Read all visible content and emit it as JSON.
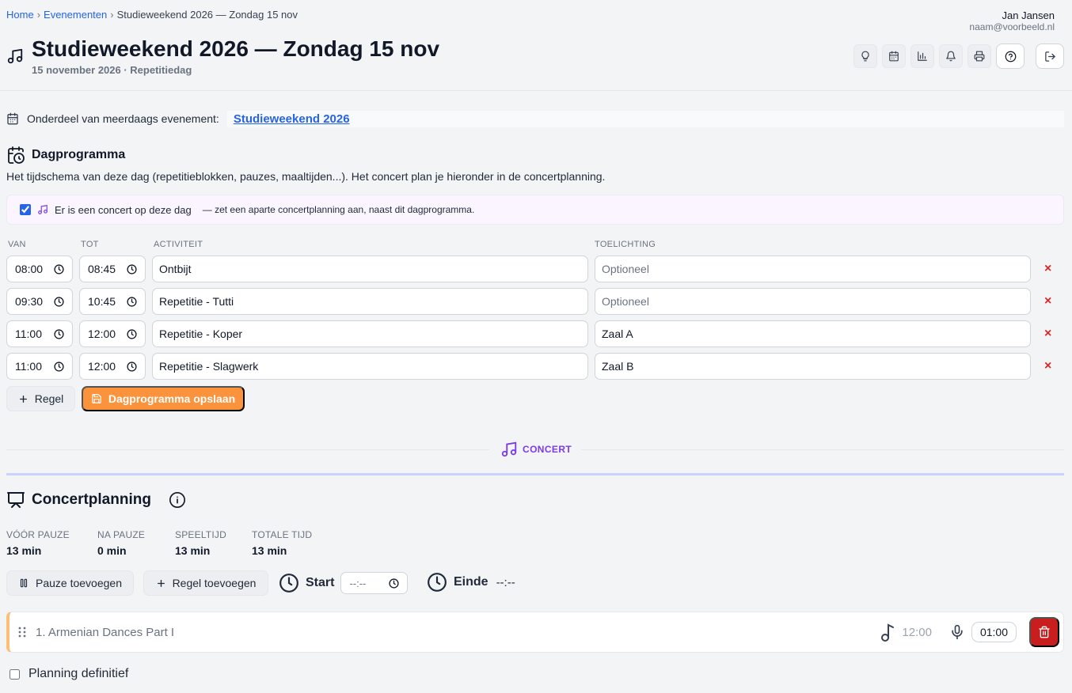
{
  "breadcrumb": {
    "home": "Home",
    "events": "Evenementen",
    "separator": "›",
    "current": "Studieweekend 2026 — Zondag 15 nov"
  },
  "user": {
    "name": "Jan Jansen",
    "email": "naam@voorbeeld.nl"
  },
  "header": {
    "title": "Studieweekend 2026 — Zondag 15 nov",
    "subtitle": "15 november 2026 · Repetitiedag",
    "toolbar_icons": [
      "lightbulb-icon",
      "calendar-icon",
      "chart-icon",
      "bell-icon",
      "printer-icon",
      "help-icon",
      "logout-icon"
    ]
  },
  "parent_event": {
    "label": "Onderdeel van meerdaags evenement:",
    "link": "Studieweekend 2026"
  },
  "day_program": {
    "heading": "Dagprogramma",
    "description": "Het tijdschema van deze dag (repetitieblokken, pauzes, maaltijden...). Het concert plan je hieronder in de concertplanning.",
    "concert_toggle": {
      "checked": true,
      "label": "Er is een concert op deze dag",
      "hint": "— zet een aparte concertplanning aan, naast dit dagprogramma."
    },
    "columns": {
      "from": "VAN",
      "to": "TOT",
      "activity": "ACTIVITEIT",
      "note": "TOELICHTING"
    },
    "note_placeholder": "Optioneel",
    "rows": [
      {
        "from": "08:00",
        "to": "08:45",
        "activity": "Ontbijt",
        "note": ""
      },
      {
        "from": "09:30",
        "to": "10:45",
        "activity": "Repetitie - Tutti",
        "note": ""
      },
      {
        "from": "11:00",
        "to": "12:00",
        "activity": "Repetitie - Koper",
        "note": "Zaal A"
      },
      {
        "from": "11:00",
        "to": "12:00",
        "activity": "Repetitie - Slagwerk",
        "note": "Zaal B"
      }
    ],
    "delete_symbol": "×",
    "add_row_label": "Regel",
    "save_label": "Dagprogramma opslaan"
  },
  "divider": {
    "label": "CONCERT"
  },
  "concert": {
    "heading": "Concertplanning",
    "stats": [
      {
        "label": "VÓÓR PAUZE",
        "value": "13 min"
      },
      {
        "label": "NA PAUZE",
        "value": "0 min"
      },
      {
        "label": "SPEELTIJD",
        "value": "13 min"
      },
      {
        "label": "TOTALE TIJD",
        "value": "13 min"
      }
    ],
    "add_pause_label": "Pauze toevoegen",
    "add_row_label": "Regel toevoegen",
    "start_label": "Start",
    "start_value": "--:--",
    "end_label": "Einde",
    "end_value": "--:--",
    "pieces": [
      {
        "number": "1.",
        "title": "Armenian Dances Part I",
        "duration": "12:00",
        "speech_time": "01:00"
      }
    ],
    "final_checkbox": {
      "checked": false,
      "label": "Planning definitief"
    }
  },
  "colors": {
    "link": "#2563eb",
    "accent_orange": "#fb923c",
    "concert_purple": "#7c3aed",
    "danger": "#dc2626"
  }
}
